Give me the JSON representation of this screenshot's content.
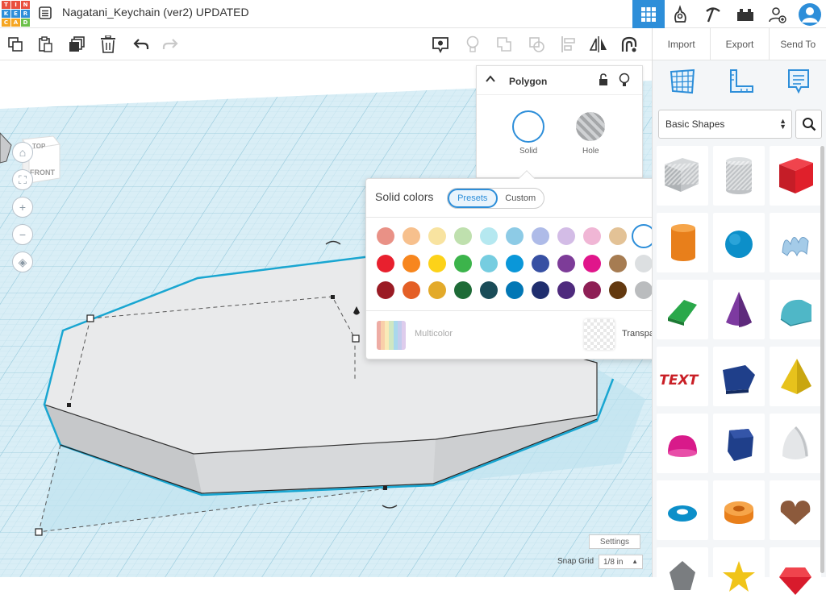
{
  "app": {
    "logo_letters": [
      "T",
      "I",
      "N",
      "K",
      "E",
      "R",
      "C",
      "A",
      "D"
    ],
    "logo_colors": [
      "#e94f3d",
      "#e94f3d",
      "#e94f3d",
      "#2d8ed9",
      "#2d8ed9",
      "#2d8ed9",
      "#f5a623",
      "#f5a623",
      "#6cc04a"
    ],
    "title": "Nagatani_Keychain (ver2) UPDATED"
  },
  "topbar": {
    "icons": [
      "grid-view-icon",
      "gallery-icon",
      "pickaxe-icon",
      "bricks-icon",
      "add-user-icon",
      "avatar-icon"
    ],
    "active_color": "#2d8ed9"
  },
  "toolbar": {
    "left_icons": [
      "copy-icon",
      "paste-icon",
      "duplicate-icon",
      "delete-icon",
      "undo-icon",
      "redo-icon"
    ],
    "right_icons": [
      "notes-icon",
      "light-icon",
      "group-icon",
      "ungroup-icon",
      "align-icon",
      "mirror-icon",
      "cruise-icon"
    ]
  },
  "right_panel": {
    "import_label": "Import",
    "export_label": "Export",
    "sendto_label": "Send To",
    "tool_icons": [
      "workplane-icon",
      "ruler-icon",
      "notes-icon"
    ],
    "shape_category": "Basic Shapes",
    "shapes": [
      "box-hole",
      "cylinder-hole",
      "box",
      "cylinder",
      "sphere",
      "scribble",
      "roof",
      "cone",
      "round-roof",
      "text",
      "polygon",
      "pyramid",
      "half-sphere",
      "polyhedron",
      "paraboloid",
      "torus",
      "tube",
      "heart",
      "icosahedron",
      "star",
      "gem"
    ]
  },
  "viewport": {
    "viewcube_top": "TOP",
    "viewcube_front": "FRONT",
    "settings_label": "Settings",
    "snap_label": "Snap Grid",
    "snap_value": "1/8 in"
  },
  "inspector": {
    "title": "Polygon",
    "solid_label": "Solid",
    "hole_label": "Hole"
  },
  "color_picker": {
    "title": "Solid colors",
    "tab_presets": "Presets",
    "tab_custom": "Custom",
    "rows": [
      [
        "#e99186",
        "#f7c08d",
        "#f8e3a0",
        "#bfe0ae",
        "#b5e8f0",
        "#8dcbe6",
        "#aebbe8",
        "#d3bce6",
        "#f0b6d5",
        "#e3c296",
        "#ffffff",
        "#a7aaad"
      ],
      [
        "#e8202e",
        "#f7861e",
        "#fcd219",
        "#3cb44b",
        "#76cde0",
        "#0a97d9",
        "#3750a3",
        "#7d3c98",
        "#e0168b",
        "#a67c52",
        "#dcdfe1",
        "#6d6f71"
      ],
      [
        "#9a1b24",
        "#e45f26",
        "#e3aa2a",
        "#1e6b37",
        "#1a4c58",
        "#0277b5",
        "#1f2e6e",
        "#4e2a7d",
        "#8e1f55",
        "#63390f",
        "#babcbe",
        "#2e2f31"
      ]
    ],
    "selected": "#ffffff",
    "multicolor_label": "Multicolor",
    "multicolor_colors": [
      "#e99186",
      "#f7c08d",
      "#f8e3a0",
      "#bfe0ae",
      "#8dcbe6",
      "#aebbe8",
      "#d3bce6"
    ],
    "transparent_label": "Transparent"
  }
}
